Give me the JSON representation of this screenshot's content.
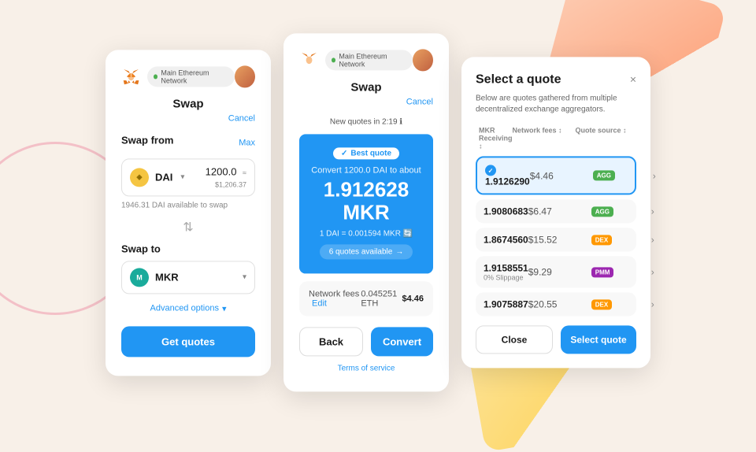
{
  "background": {
    "circle_color": "#f0a0b0",
    "triangle_orange": "#ff9060",
    "triangle_yellow": "#ffd040"
  },
  "panel1": {
    "network": "Main Ethereum Network",
    "title": "Swap",
    "cancel": "Cancel",
    "swap_from_label": "Swap from",
    "max_label": "Max",
    "from_token": "DAI",
    "from_amount": "1200.0",
    "from_usd": "≈ $1,206.37",
    "available": "1946.31 DAI available to swap",
    "swap_to_label": "Swap to",
    "to_token": "MKR",
    "advanced_options": "Advanced options",
    "get_quotes_btn": "Get quotes"
  },
  "panel2": {
    "network": "Main Ethereum Network",
    "title": "Swap",
    "cancel": "Cancel",
    "new_quotes": "New quotes in 2:19",
    "best_quote_label": "Best quote",
    "convert_text": "Convert 1200.0 DAI to about",
    "convert_amount": "1.912628 MKR",
    "exchange_rate": "1 DAI = 0.001594 MKR",
    "quotes_available": "6 quotes available",
    "network_fees_label": "Network fees",
    "edit_label": "Edit",
    "fee_eth": "0.045251 ETH",
    "fee_usd": "$4.46",
    "back_btn": "Back",
    "convert_btn": "Convert",
    "tos": "Terms of service"
  },
  "panel3": {
    "title": "Select a quote",
    "description": "Below are quotes gathered from multiple decentralized exchange aggregators.",
    "close_btn": "×",
    "col_receiving": "MKR\nReceiving",
    "col_network_fees": "Network\nfees",
    "col_quote_source": "Quote\nsource",
    "quotes": [
      {
        "amount": "1.9126290",
        "slippage": "",
        "fee": "$4.46",
        "source_type": "AGG",
        "selected": true
      },
      {
        "amount": "1.9080683",
        "slippage": "",
        "fee": "$6.47",
        "source_type": "AGG",
        "selected": false
      },
      {
        "amount": "1.8674560",
        "slippage": "",
        "fee": "$15.52",
        "source_type": "DEX",
        "selected": false
      },
      {
        "amount": "1.9158551",
        "slippage": "0% Slippage",
        "fee": "$9.29",
        "source_type": "PMM",
        "selected": false
      },
      {
        "amount": "1.9075887",
        "slippage": "",
        "fee": "$20.55",
        "source_type": "DEX",
        "selected": false
      }
    ],
    "close_footer_btn": "Close",
    "select_quote_btn": "Select quote"
  }
}
